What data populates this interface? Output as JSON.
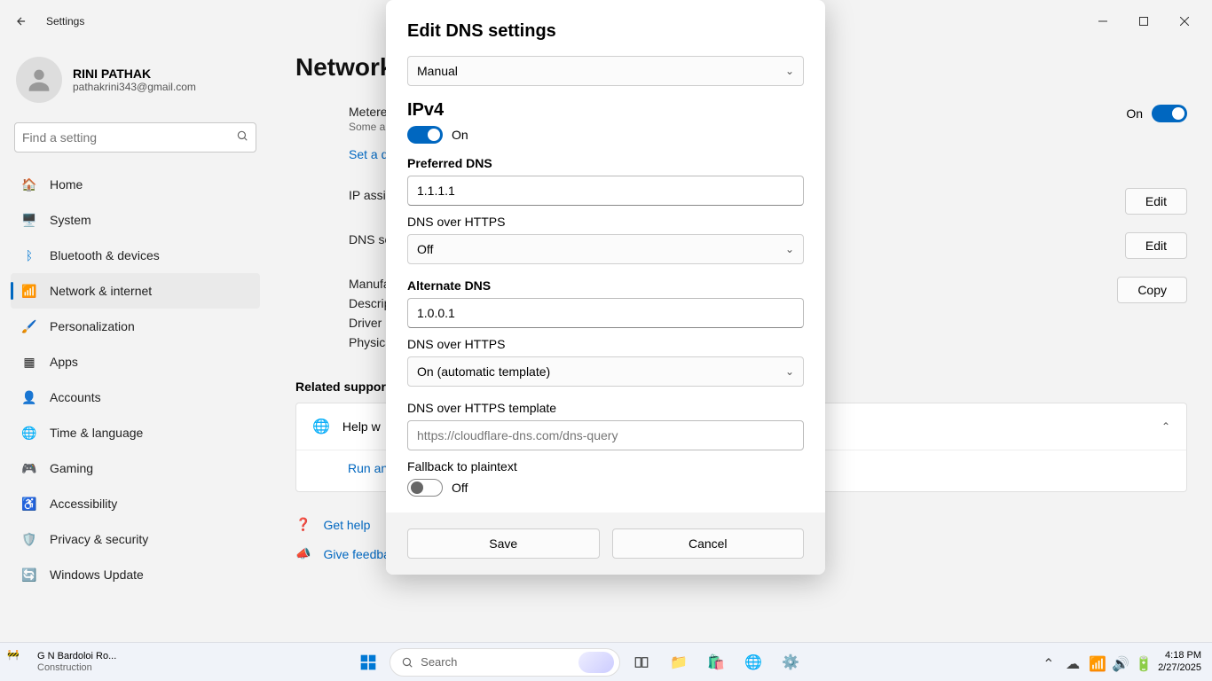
{
  "window": {
    "title": "Settings"
  },
  "user": {
    "name": "RINI PATHAK",
    "email": "pathakrini343@gmail.com"
  },
  "search": {
    "placeholder": "Find a setting"
  },
  "nav": {
    "items": [
      {
        "label": "Home",
        "icon": "home"
      },
      {
        "label": "System",
        "icon": "system"
      },
      {
        "label": "Bluetooth & devices",
        "icon": "bluetooth"
      },
      {
        "label": "Network & internet",
        "icon": "wifi",
        "active": true
      },
      {
        "label": "Personalization",
        "icon": "brush"
      },
      {
        "label": "Apps",
        "icon": "apps"
      },
      {
        "label": "Accounts",
        "icon": "accounts"
      },
      {
        "label": "Time & language",
        "icon": "time"
      },
      {
        "label": "Gaming",
        "icon": "gaming"
      },
      {
        "label": "Accessibility",
        "icon": "accessibility"
      },
      {
        "label": "Privacy & security",
        "icon": "privacy"
      },
      {
        "label": "Windows Update",
        "icon": "update"
      }
    ]
  },
  "page": {
    "header": "Network",
    "metered": {
      "title": "Metere",
      "sub": "Some a",
      "toggle_label": "On"
    },
    "set_limit": "Set a d",
    "rows": {
      "ip_assign": "IP assig",
      "dns_assign": "DNS se",
      "manufacturer": "Manufa",
      "description": "Descrip",
      "driver": "Driver",
      "physical": "Physica"
    },
    "buttons": {
      "edit": "Edit",
      "copy": "Copy"
    },
    "related": "Related support",
    "help_with": "Help w",
    "run_and": "Run an",
    "get_help": "Get help",
    "give_feedback": "Give feedba"
  },
  "modal": {
    "title": "Edit DNS settings",
    "mode": "Manual",
    "ipv4_label": "IPv4",
    "ipv4_on": "On",
    "preferred_label": "Preferred DNS",
    "preferred_value": "1.1.1.1",
    "doh1_label": "DNS over HTTPS",
    "doh1_value": "Off",
    "alternate_label": "Alternate DNS",
    "alternate_value": "1.0.0.1",
    "doh2_label": "DNS over HTTPS",
    "doh2_value": "On (automatic template)",
    "template_label": "DNS over HTTPS template",
    "template_placeholder": "https://cloudflare-dns.com/dns-query",
    "fallback_label": "Fallback to plaintext",
    "fallback_value": "Off",
    "save": "Save",
    "cancel": "Cancel"
  },
  "taskbar": {
    "weather_line1": "G N Bardoloi Ro...",
    "weather_line2": "Construction",
    "search": "Search",
    "time": "4:18 PM",
    "date": "2/27/2025"
  }
}
